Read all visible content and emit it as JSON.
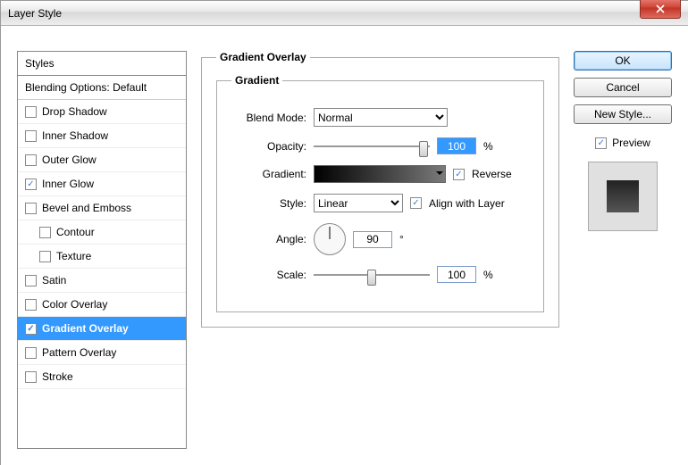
{
  "window": {
    "title": "Layer Style"
  },
  "sidebar": {
    "header": "Styles",
    "blending": "Blending Options: Default",
    "items": [
      {
        "label": "Drop Shadow",
        "checked": false,
        "sub": false
      },
      {
        "label": "Inner Shadow",
        "checked": false,
        "sub": false
      },
      {
        "label": "Outer Glow",
        "checked": false,
        "sub": false
      },
      {
        "label": "Inner Glow",
        "checked": true,
        "sub": false
      },
      {
        "label": "Bevel and Emboss",
        "checked": false,
        "sub": false
      },
      {
        "label": "Contour",
        "checked": false,
        "sub": true
      },
      {
        "label": "Texture",
        "checked": false,
        "sub": true
      },
      {
        "label": "Satin",
        "checked": false,
        "sub": false
      },
      {
        "label": "Color Overlay",
        "checked": false,
        "sub": false
      },
      {
        "label": "Gradient Overlay",
        "checked": true,
        "sub": false,
        "selected": true
      },
      {
        "label": "Pattern Overlay",
        "checked": false,
        "sub": false
      },
      {
        "label": "Stroke",
        "checked": false,
        "sub": false
      }
    ]
  },
  "panel": {
    "group_title": "Gradient Overlay",
    "inner_title": "Gradient",
    "blend_mode_label": "Blend Mode:",
    "blend_mode_value": "Normal",
    "opacity_label": "Opacity:",
    "opacity_value": "100",
    "opacity_unit": "%",
    "gradient_label": "Gradient:",
    "reverse_label": "Reverse",
    "reverse_checked": true,
    "style_label": "Style:",
    "style_value": "Linear",
    "align_label": "Align with Layer",
    "align_checked": true,
    "angle_label": "Angle:",
    "angle_value": "90",
    "angle_unit": "°",
    "scale_label": "Scale:",
    "scale_value": "100",
    "scale_unit": "%"
  },
  "buttons": {
    "ok": "OK",
    "cancel": "Cancel",
    "new_style": "New Style...",
    "preview_label": "Preview",
    "preview_checked": true
  }
}
